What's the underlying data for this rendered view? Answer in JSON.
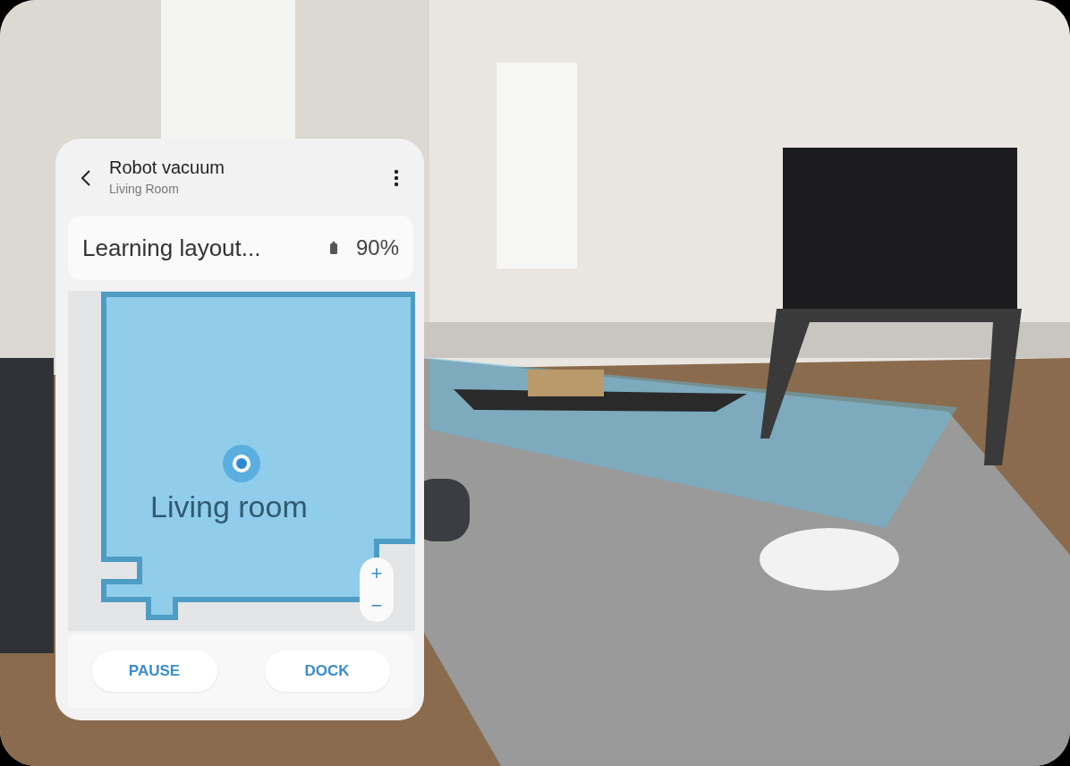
{
  "app": {
    "title": "Robot vacuum",
    "subtitle": "Living Room",
    "status": "Learning layout...",
    "battery": "90%",
    "map": {
      "room_label": "Living room"
    },
    "zoom": [
      "+",
      "−"
    ],
    "buttons": [
      "PAUSE",
      "DOCK"
    ]
  }
}
